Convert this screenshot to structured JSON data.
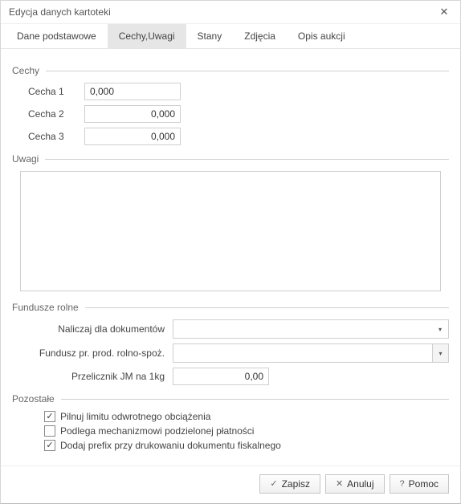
{
  "window": {
    "title": "Edycja danych kartoteki"
  },
  "tabs": [
    {
      "label": "Dane podstawowe",
      "active": false
    },
    {
      "label": "Cechy,Uwagi",
      "active": true
    },
    {
      "label": "Stany",
      "active": false
    },
    {
      "label": "Zdjęcia",
      "active": false
    },
    {
      "label": "Opis aukcji",
      "active": false
    }
  ],
  "cechy": {
    "title": "Cechy",
    "rows": [
      {
        "label": "Cecha 1",
        "value": "0,000",
        "align": "left"
      },
      {
        "label": "Cecha 2",
        "value": "0,000",
        "align": "right"
      },
      {
        "label": "Cecha 3",
        "value": "0,000",
        "align": "right"
      }
    ]
  },
  "uwagi": {
    "title": "Uwagi",
    "value": ""
  },
  "fundusze": {
    "title": "Fundusze rolne",
    "naliczaj_label": "Naliczaj dla dokumentów",
    "naliczaj_value": "",
    "fundusz_label": "Fundusz pr. prod. rolno-spoż.",
    "fundusz_value": "",
    "przelicznik_label": "Przelicznik JM na 1kg",
    "przelicznik_value": "0,00"
  },
  "pozostale": {
    "title": "Pozostałe",
    "items": [
      {
        "checked": true,
        "label": "Pilnuj limitu odwrotnego obciążenia"
      },
      {
        "checked": false,
        "label": "Podlega mechanizmowi podzielonej płatności"
      },
      {
        "checked": true,
        "label": "Dodaj prefix przy drukowaniu dokumentu fiskalnego"
      }
    ]
  },
  "buttons": {
    "save": "Zapisz",
    "cancel": "Anuluj",
    "help": "Pomoc"
  }
}
